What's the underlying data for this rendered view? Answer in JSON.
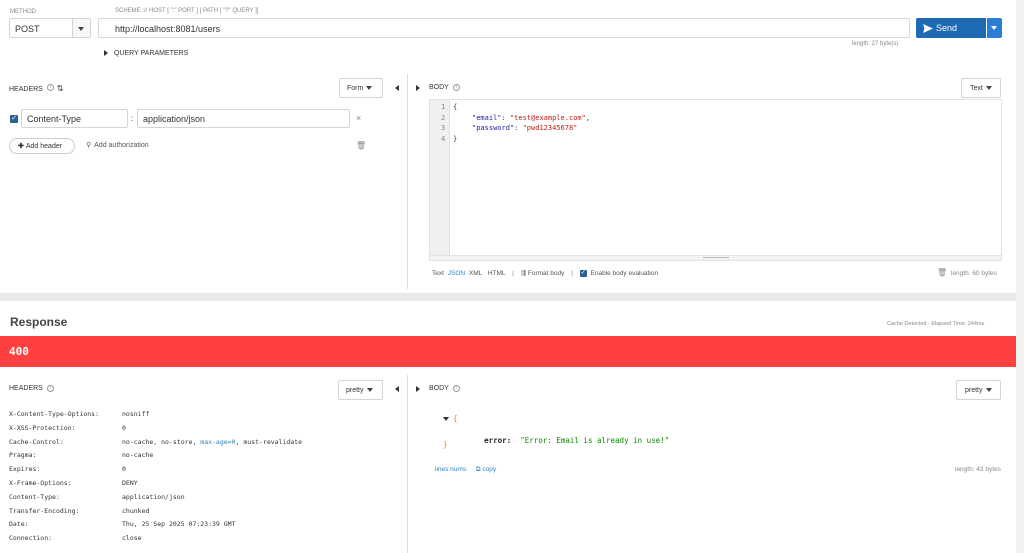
{
  "request": {
    "method_label": "METHOD",
    "method_value": "POST",
    "url_hint": "SCHEME :// HOST [ \":\" PORT ] [ PATH [ \"?\" QUERY ]]",
    "url": "http://localhost:8081/users",
    "url_length": "length: 27 byte(s)",
    "send_label": "Send",
    "query_params_label": "QUERY PARAMETERS"
  },
  "req_headers": {
    "title": "HEADERS",
    "mode": "Form",
    "key": "Content-Type",
    "value": "application/json",
    "add_header": "Add header",
    "add_auth": "Add authorization"
  },
  "req_body": {
    "title": "BODY",
    "mode": "Text",
    "lines": [
      {
        "n": "1",
        "text": "{"
      },
      {
        "n": "2",
        "key": "\"email\"",
        "val": "\"test@example.com\"",
        "tail": ","
      },
      {
        "n": "3",
        "key": "\"password\"",
        "val": "\"pwd12345678\"",
        "tail": ""
      },
      {
        "n": "4",
        "text": "}"
      }
    ],
    "formats": [
      "Text",
      "JSON",
      "XML",
      "HTML"
    ],
    "active_format": "JSON",
    "format_body": "Format body",
    "enable_eval": "Enable body evaluation",
    "length": "length: 60 bytes"
  },
  "response": {
    "title": "Response",
    "cache_info": "Cache Detected - Elapsed Time: 244ms",
    "status": "400",
    "status_color": "#ff4040",
    "headers_title": "HEADERS",
    "headers_mode": "pretty",
    "headers": [
      {
        "k": "X-Content-Type-Options:",
        "v": "nosniff"
      },
      {
        "k": "X-XSS-Protection:",
        "v": "0"
      },
      {
        "k": "Cache-Control:",
        "v": "no-cache, no-store, max-age=0, must-revalidate"
      },
      {
        "k": "Pragma:",
        "v": "no-cache"
      },
      {
        "k": "Expires:",
        "v": "0"
      },
      {
        "k": "X-Frame-Options:",
        "v": "DENY"
      },
      {
        "k": "Content-Type:",
        "v": "application/json"
      },
      {
        "k": "Transfer-Encoding:",
        "v": "chunked"
      },
      {
        "k": "Date:",
        "v": "Thu, 25 Sep 2025 07:23:39 GMT"
      },
      {
        "k": "Connection:",
        "v": "close"
      }
    ],
    "cache_control_prefix": "no-cache, no-store, ",
    "cache_control_link": "max-age=0",
    "cache_control_suffix": ", must-revalidate",
    "body_title": "BODY",
    "body_mode": "pretty",
    "body_open": "{",
    "body_key": "error:",
    "body_value": "\"Error: Email is already in use!\"",
    "body_close": "}",
    "lines_nums": "lines nums",
    "copy": "copy",
    "length": "length: 43 bytes"
  }
}
